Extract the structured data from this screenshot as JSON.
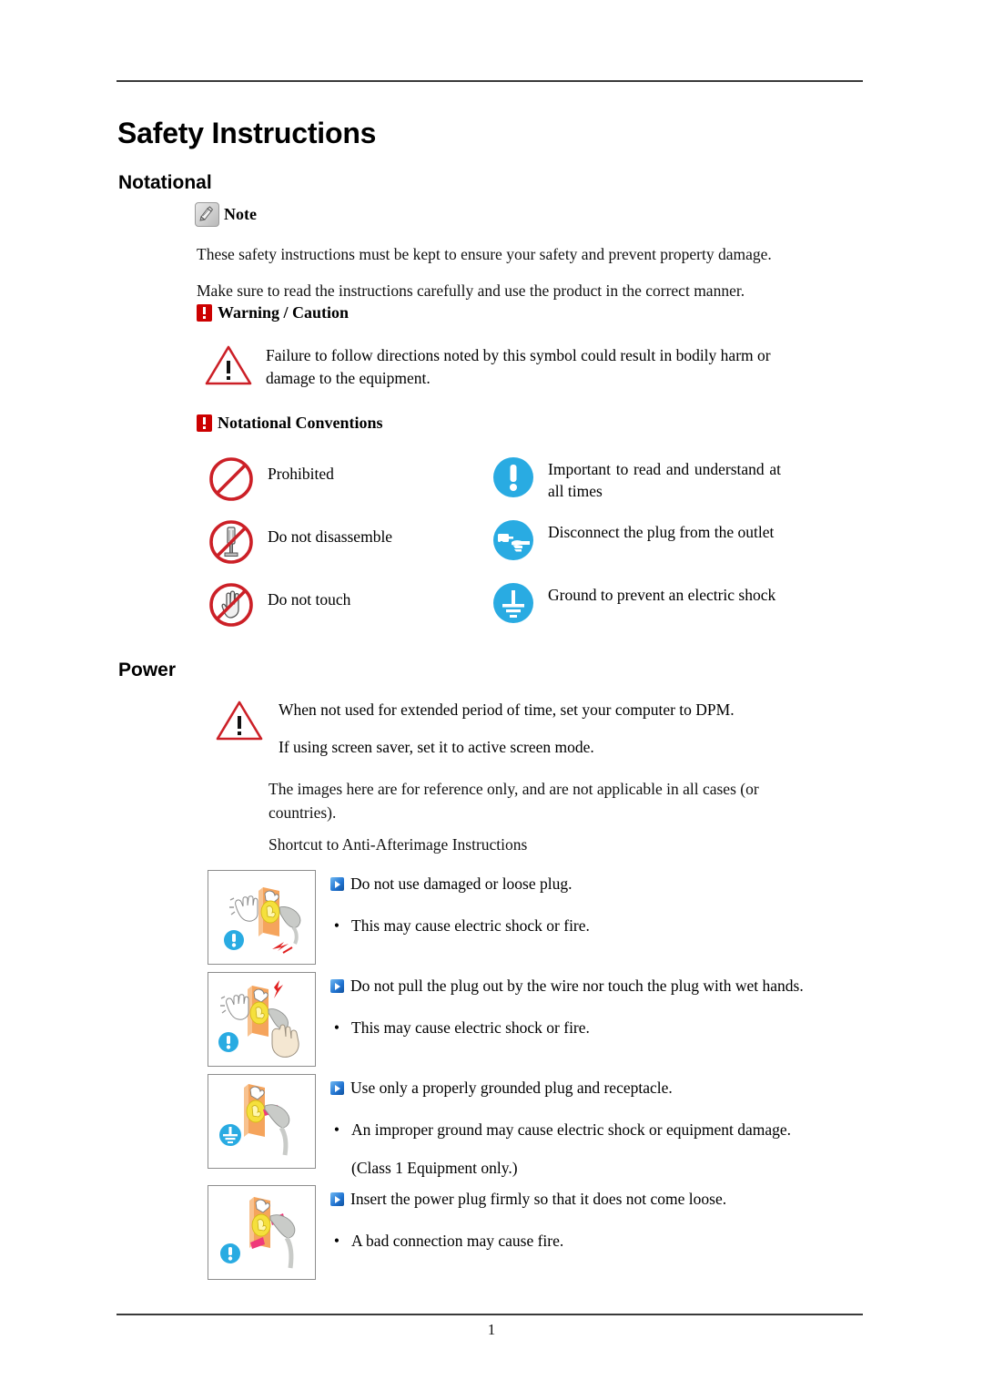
{
  "document": {
    "title": "Safety Instructions",
    "page_number": "1"
  },
  "sections": {
    "notational": {
      "heading": "Notational",
      "note_label": "Note",
      "note_icon": "note-pen-icon",
      "paragraphs": [
        "These safety instructions must be kept to ensure your safety and prevent property damage.",
        "Make sure to read the instructions carefully and use the product in the correct manner."
      ],
      "warning_caution": {
        "heading": "Warning / Caution",
        "icon": "red-exclamation-icon",
        "body": "Failure to follow directions noted by this symbol could result in bodily harm or damage to the equipment.",
        "body_icon": "warning-triangle-icon"
      },
      "conventions": {
        "heading": "Notational Conventions",
        "icon": "red-exclamation-icon",
        "rows": [
          {
            "left": {
              "icon": "prohibited-icon",
              "label": "Prohibited"
            },
            "right": {
              "icon": "important-exclamation-icon",
              "label": "Important to read and understand at all times"
            }
          },
          {
            "left": {
              "icon": "do-not-disassemble-icon",
              "label": "Do not disassemble"
            },
            "right": {
              "icon": "disconnect-plug-icon",
              "label": "Disconnect the plug from the outlet"
            }
          },
          {
            "left": {
              "icon": "do-not-touch-icon",
              "label": "Do not touch"
            },
            "right": {
              "icon": "ground-icon",
              "label": "Ground to prevent an electric shock"
            }
          }
        ]
      }
    },
    "power": {
      "heading": "Power",
      "warning_icon": "warning-triangle-icon",
      "warning_lines": [
        "When not used for extended period of time, set your computer to DPM.",
        "If using screen saver, set it to active screen mode."
      ],
      "notes": [
        "The images here are for reference only, and are not applicable in all cases (or countries).",
        "Shortcut to Anti-Afterimage Instructions"
      ],
      "items": [
        {
          "illustration": "damaged-loose-plug-illustration",
          "badge": "important-exclamation-icon",
          "marker": "blue-triangle-marker",
          "heading": "Do not use damaged or loose plug.",
          "bullet_symbol": "•",
          "bullet": "This may cause electric shock or fire.",
          "extra": ""
        },
        {
          "illustration": "wet-hands-plug-illustration",
          "badge": "important-exclamation-icon",
          "marker": "blue-triangle-marker",
          "heading": "Do not pull the plug out by the wire nor touch the plug with wet hands.",
          "bullet_symbol": "•",
          "bullet": "This may cause electric shock or fire.",
          "extra": ""
        },
        {
          "illustration": "grounded-plug-illustration",
          "badge": "ground-icon",
          "marker": "blue-triangle-marker",
          "heading": "Use only a properly grounded plug and receptacle.",
          "bullet_symbol": "•",
          "bullet": "An improper ground may cause electric shock or equipment damage.",
          "extra": "(Class 1 Equipment only.)"
        },
        {
          "illustration": "insert-plug-firmly-illustration",
          "badge": "important-exclamation-icon",
          "marker": "blue-triangle-marker",
          "heading": "Insert the power plug firmly so that it does not come loose.",
          "bullet_symbol": "•",
          "bullet": "A bad connection may cause fire.",
          "extra": ""
        }
      ]
    }
  },
  "colors": {
    "prohibited_red": "#cc2027",
    "warning_red": "#cc0000",
    "info_blue": "#29abe2",
    "rule_gray": "#3a3a3a",
    "illustration_orange": "#f5a45c",
    "illustration_yellow": "#f5e03c",
    "plug_gray": "#c9cbc8"
  }
}
